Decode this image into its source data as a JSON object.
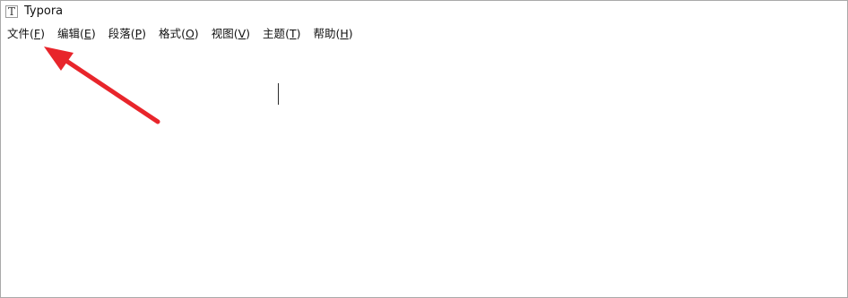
{
  "window": {
    "title": "Typora",
    "app_icon_glyph": "T"
  },
  "menubar": {
    "items": [
      {
        "label": "文件",
        "mnemonic": "F",
        "open": "(",
        "close": ")"
      },
      {
        "label": "编辑",
        "mnemonic": "E",
        "open": "(",
        "close": ")"
      },
      {
        "label": "段落",
        "mnemonic": "P",
        "open": "(",
        "close": ")"
      },
      {
        "label": "格式",
        "mnemonic": "O",
        "open": "(",
        "close": ")"
      },
      {
        "label": "视图",
        "mnemonic": "V",
        "open": "(",
        "close": ")"
      },
      {
        "label": "主题",
        "mnemonic": "T",
        "open": "(",
        "close": ")"
      },
      {
        "label": "帮助",
        "mnemonic": "H",
        "open": "(",
        "close": ")"
      }
    ]
  },
  "annotation": {
    "icon": "red-arrow-icon",
    "color": "#e8252b"
  },
  "colors": {
    "background": "#ffffff",
    "window_border": "#a9a9a9",
    "text": "#111111"
  }
}
